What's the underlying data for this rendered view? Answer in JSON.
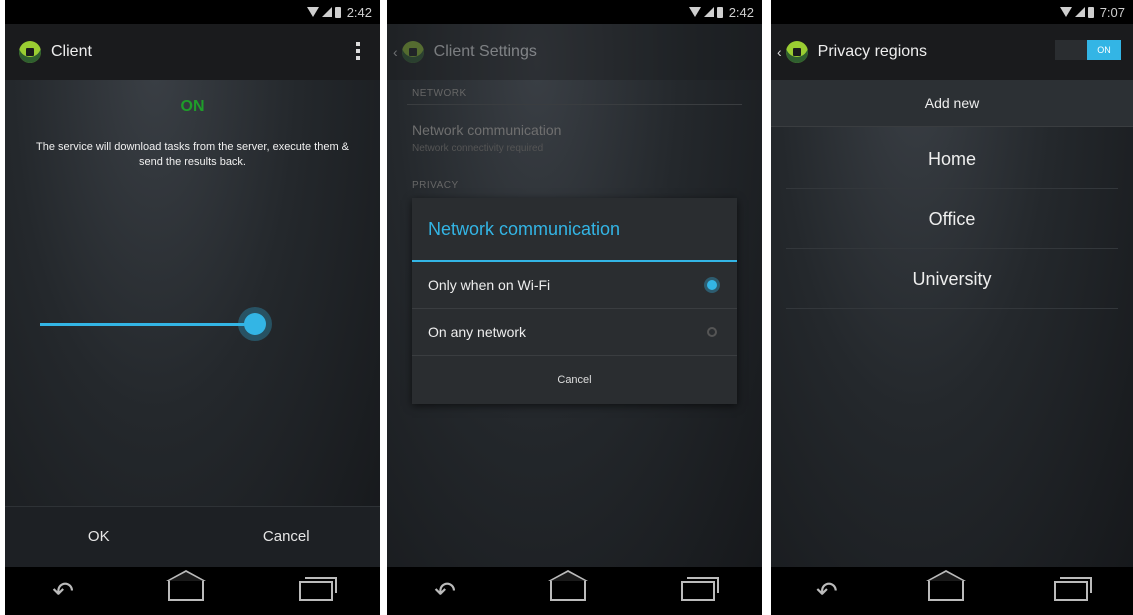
{
  "status": {
    "time_a": "2:42",
    "time_b": "2:42",
    "time_c": "7:07"
  },
  "screen1": {
    "title": "Client",
    "state": "ON",
    "description": "The service will download tasks from the server, execute them & send the results back.",
    "slider_level": 1.0,
    "ok_label": "OK",
    "cancel_label": "Cancel"
  },
  "screen2": {
    "title": "Client Settings",
    "category_network": "NETWORK",
    "pref_title": "Network communication",
    "pref_summary": "Network connectivity required",
    "category_privacy": "PRIVACY",
    "dialog": {
      "title": "Network communication",
      "options": [
        {
          "label": "Only when on Wi-Fi",
          "selected": true
        },
        {
          "label": "On any network",
          "selected": false
        }
      ],
      "cancel_label": "Cancel"
    }
  },
  "screen3": {
    "title": "Privacy regions",
    "toggle_label": "ON",
    "add_new_label": "Add new",
    "regions": [
      "Home",
      "Office",
      "University"
    ]
  },
  "colors": {
    "accent": "#33b5e5",
    "on_green": "#1f9d2a"
  }
}
